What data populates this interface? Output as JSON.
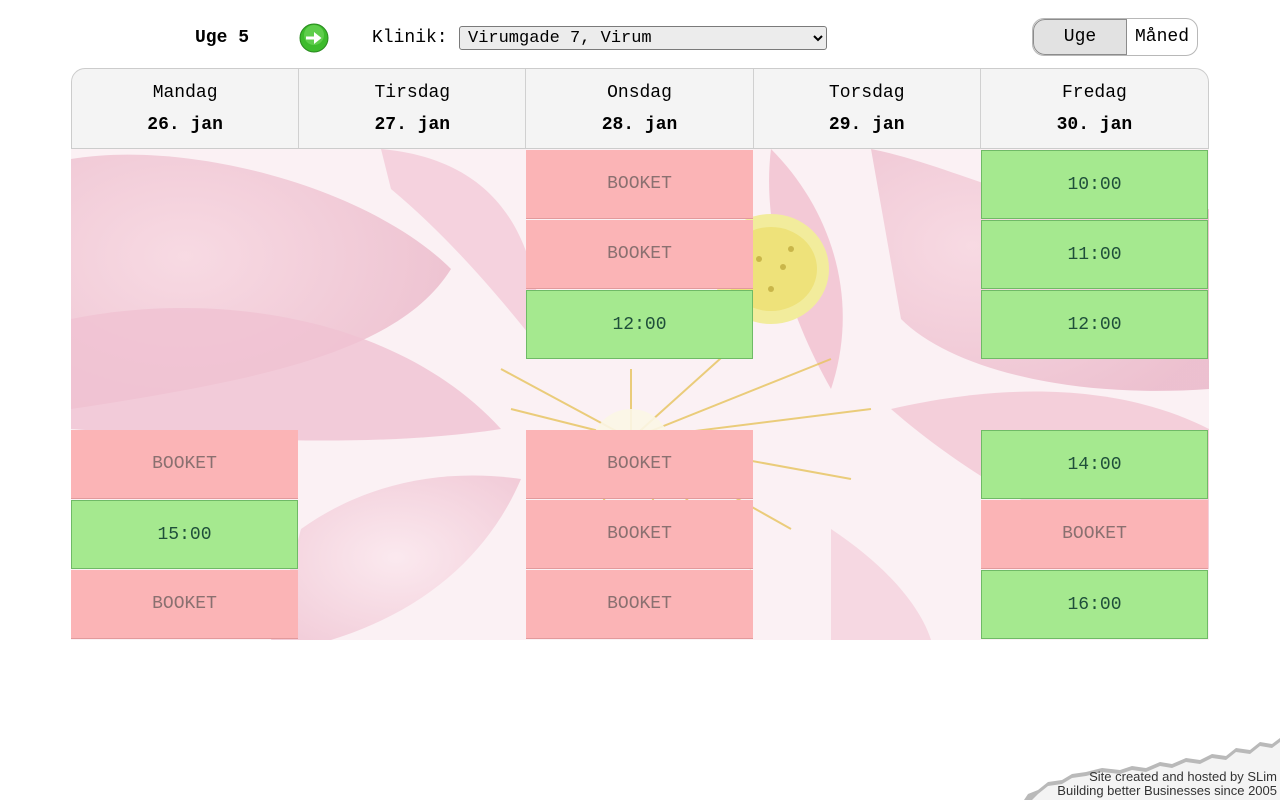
{
  "toolbar": {
    "week_label": "Uge 5",
    "next_icon": "arrow-right-circle-icon",
    "clinic_label": "Klinik:",
    "clinic_selected": "Virumgade 7, Virum",
    "view_week": "Uge",
    "view_month": "Måned"
  },
  "colors": {
    "booked": "#fbb4b6",
    "available": "#a5e98f",
    "header_bg": "#f4f4f4",
    "next_button": "#3dbb2c"
  },
  "days": [
    {
      "name": "Mandag",
      "date": "26. jan"
    },
    {
      "name": "Tirsdag",
      "date": "27. jan"
    },
    {
      "name": "Onsdag",
      "date": "28. jan"
    },
    {
      "name": "Torsdag",
      "date": "29. jan"
    },
    {
      "name": "Fredag",
      "date": "30. jan"
    }
  ],
  "slots": {
    "mon_1400": "BOOKET",
    "mon_1500": "15:00",
    "mon_1600": "BOOKET",
    "wed_1000": "BOOKET",
    "wed_1100": "BOOKET",
    "wed_1200": "12:00",
    "wed_1400": "BOOKET",
    "wed_1500": "BOOKET",
    "wed_1600": "BOOKET",
    "fri_1000": "10:00",
    "fri_1100": "11:00",
    "fri_1200": "12:00",
    "fri_1400": "14:00",
    "fri_1500": "BOOKET",
    "fri_1600": "16:00"
  },
  "footer": {
    "line1": "Site created and hosted by SLim",
    "line2": "Building better Businesses since 2005"
  }
}
